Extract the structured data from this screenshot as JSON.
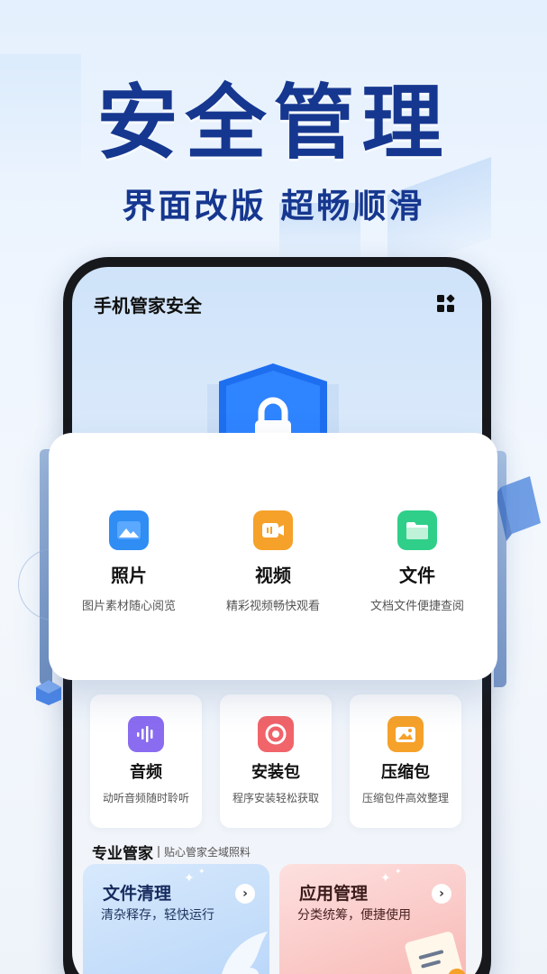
{
  "hero": {
    "title": "安全管理",
    "subtitle": "界面改版 超畅顺滑"
  },
  "app": {
    "title": "手机管家安全",
    "menu_icon": "grid-apps-icon"
  },
  "featured": [
    {
      "name": "照片",
      "desc": "图片素材随心阅览",
      "icon": "photo-icon",
      "color": "#2f8df4"
    },
    {
      "name": "视频",
      "desc": "精彩视频畅快观看",
      "icon": "video-icon",
      "color": "#f5a12a"
    },
    {
      "name": "文件",
      "desc": "文档文件便捷查阅",
      "icon": "folder-icon",
      "color": "#2fcf8a"
    }
  ],
  "tools": [
    {
      "name": "音频",
      "desc": "动听音频随时聆听",
      "icon": "audio-icon",
      "color": "#8a6cf0"
    },
    {
      "name": "安装包",
      "desc": "程序安装轻松获取",
      "icon": "package-icon",
      "color": "#f0646a"
    },
    {
      "name": "压缩包",
      "desc": "压缩包件高效整理",
      "icon": "archive-icon",
      "color": "#f5a12a"
    }
  ],
  "pro": {
    "title": "专业管家",
    "subtitle": "贴心管家全域照料"
  },
  "cards": [
    {
      "title": "文件清理",
      "desc": "清杂释存，轻快运行",
      "arrow": "›",
      "accent": "#b9d6f9"
    },
    {
      "title": "应用管理",
      "desc": "分类统筹，便捷使用",
      "arrow": "›",
      "accent": "#f7b7b3"
    }
  ],
  "colors": {
    "brand_navy": "#16378f",
    "shield_blue": "#1e6ff0"
  }
}
